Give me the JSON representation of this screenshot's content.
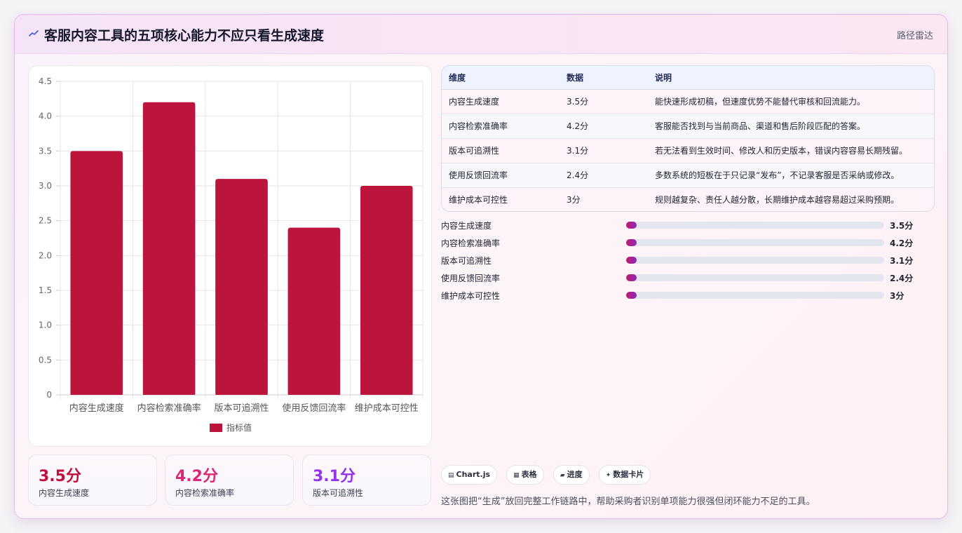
{
  "header": {
    "title": "客服内容工具的五项核心能力不应只看生成速度",
    "tag": "路径雷达",
    "icon": "trend-line-icon"
  },
  "chart_data": {
    "type": "bar",
    "categories": [
      "内容生成速度",
      "内容检索准确率",
      "版本可追溯性",
      "使用反馈回流率",
      "维护成本可控性"
    ],
    "series": [
      {
        "name": "指标值",
        "values": [
          3.5,
          4.2,
          3.1,
          2.4,
          3.0
        ]
      }
    ],
    "ylim": [
      0,
      4.5
    ],
    "yticks": [
      "0",
      "0.5",
      "1.0",
      "1.5",
      "2.0",
      "2.5",
      "3.0",
      "3.5",
      "4.0",
      "4.5"
    ],
    "grid": true,
    "legend_position": "bottom",
    "bar_color": "#bd143c"
  },
  "kpis": [
    {
      "value": "3.5分",
      "label": "内容生成速度",
      "color": "#be123c"
    },
    {
      "value": "4.2分",
      "label": "内容检索准确率",
      "color": "#db2777"
    },
    {
      "value": "3.1分",
      "label": "版本可追溯性",
      "color": "#9333ea"
    }
  ],
  "table": {
    "headers": [
      "维度",
      "数据",
      "说明"
    ],
    "rows": [
      [
        "内容生成速度",
        "3.5分",
        "能快速形成初稿，但速度优势不能替代审核和回流能力。"
      ],
      [
        "内容检索准确率",
        "4.2分",
        "客服能否找到与当前商品、渠道和售后阶段匹配的答案。"
      ],
      [
        "版本可追溯性",
        "3.1分",
        "若无法看到生效时间、修改人和历史版本，错误内容容易长期残留。"
      ],
      [
        "使用反馈回流率",
        "2.4分",
        "多数系统的短板在于只记录“发布”，不记录客服是否采纳或修改。"
      ],
      [
        "维护成本可控性",
        "3分",
        "规则越复杂、责任人越分散，长期维护成本越容易超过采购预期。"
      ]
    ]
  },
  "progress": [
    {
      "label": "内容生成速度",
      "value": "3.5分",
      "fraction": 0.04
    },
    {
      "label": "内容检索准确率",
      "value": "4.2分",
      "fraction": 0.04
    },
    {
      "label": "版本可追溯性",
      "value": "3.1分",
      "fraction": 0.04
    },
    {
      "label": "使用反馈回流率",
      "value": "2.4分",
      "fraction": 0.04
    },
    {
      "label": "维护成本可控性",
      "value": "3分",
      "fraction": 0.04
    }
  ],
  "chips": [
    {
      "icon": "▤",
      "label": "Chart.js"
    },
    {
      "icon": "▦",
      "label": "表格"
    },
    {
      "icon": "▰",
      "label": "进度"
    },
    {
      "icon": "✦",
      "label": "数据卡片"
    }
  ],
  "footnote": "这张图把“生成”放回完整工作链路中，帮助采购者识别单项能力很强但闭环能力不足的工具。"
}
